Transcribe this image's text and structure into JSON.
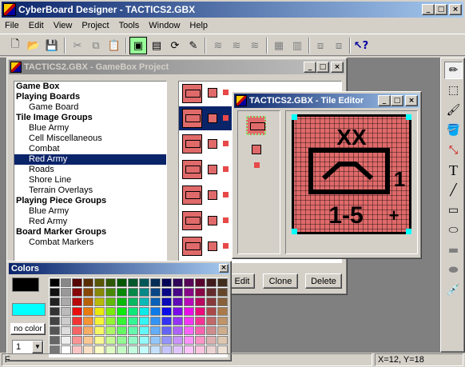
{
  "app": {
    "title": "CyberBoard Designer - TACTICS2.GBX"
  },
  "menu": [
    "File",
    "Edit",
    "View",
    "Project",
    "Tools",
    "Window",
    "Help"
  ],
  "gamebox_window": {
    "title": "TACTICS2.GBX - GameBox Project",
    "tree": [
      {
        "label": "Game Box",
        "level": 0
      },
      {
        "label": "Playing Boards",
        "level": 0
      },
      {
        "label": "Game Board",
        "level": 1
      },
      {
        "label": "Tile Image Groups",
        "level": 0
      },
      {
        "label": "Blue Army",
        "level": 1
      },
      {
        "label": "Cell Miscellaneous",
        "level": 1
      },
      {
        "label": "Combat",
        "level": 1
      },
      {
        "label": "Red Army",
        "level": 1,
        "selected": true
      },
      {
        "label": "Roads",
        "level": 1
      },
      {
        "label": "Shore Line",
        "level": 1
      },
      {
        "label": "Terrain Overlays",
        "level": 1
      },
      {
        "label": "Playing Piece Groups",
        "level": 0
      },
      {
        "label": "Blue Army",
        "level": 1
      },
      {
        "label": "Red Army",
        "level": 1
      },
      {
        "label": "Board Marker Groups",
        "level": 0
      },
      {
        "label": "Combat Markers",
        "level": 1
      }
    ],
    "buttons": {
      "edit": "Edit",
      "clone": "Clone",
      "delete": "Delete"
    }
  },
  "tile_editor": {
    "title": "TACTICS2.GBX - Tile Editor",
    "tile_text": {
      "top": "XX",
      "unit_number": "1",
      "strength": "1-5",
      "plus": "+"
    }
  },
  "colors_palette": {
    "title": "Colors",
    "no_color_label": "no color",
    "line_width_value": "1",
    "foreground_color": "#000000",
    "background_color": "#ffffff",
    "transparent_color": "#00ffff"
  },
  "status": {
    "left": "F",
    "coords": "X=12, Y=18"
  },
  "right_tools": [
    "pencil-icon",
    "select-rect-icon",
    "brush-icon",
    "fill-icon",
    "color-change-icon",
    "text-icon",
    "line-icon",
    "rect-icon",
    "ellipse-icon",
    "filled-rect-icon",
    "filled-ellipse-icon",
    "eyedropper-icon"
  ],
  "text_tool_label": "T",
  "accent": "#0a246a",
  "tile_color": "#e06a6a"
}
